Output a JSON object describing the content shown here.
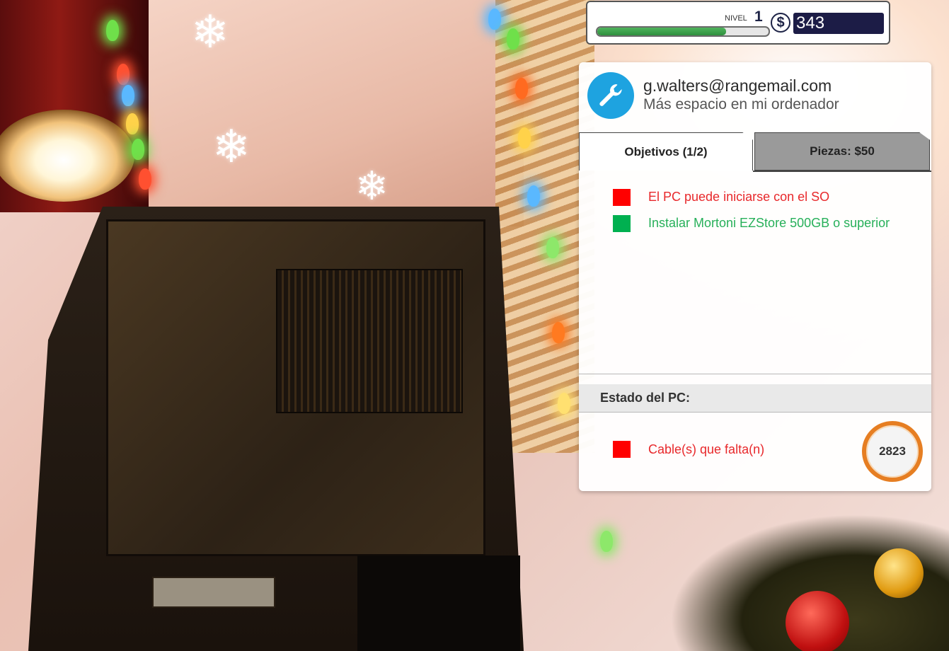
{
  "hud": {
    "level_label": "NIVEL",
    "level": "1",
    "xp_progress": 0.75,
    "currency_symbol": "$",
    "money": "343"
  },
  "job": {
    "icon": "wrench-icon",
    "email": "g.walters@rangemail.com",
    "subject": "Más espacio en mi ordenador",
    "tabs": [
      {
        "label": "Objetivos (1/2)",
        "active": true
      },
      {
        "label": "Piezas: $50",
        "active": false
      }
    ],
    "objectives": [
      {
        "text": "El PC puede iniciarse con el SO",
        "done": false,
        "color": "#e8282b"
      },
      {
        "text": "Instalar Mortoni EZStore 500GB o superior",
        "done": true,
        "color": "#27b05a"
      }
    ],
    "status_header": "Estado del PC:",
    "status_issues": [
      {
        "text": "Cable(s) que falta(n)",
        "color": "#e8282b"
      }
    ],
    "score": "2823",
    "colors": {
      "fail": "#ff0000",
      "pass": "#00b050",
      "ring": "#e67e22",
      "wrench_bg": "#1ea3e0"
    }
  }
}
